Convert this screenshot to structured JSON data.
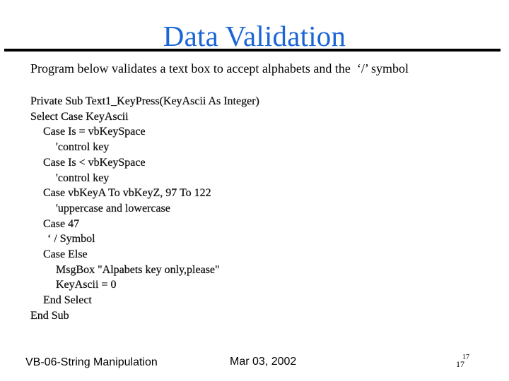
{
  "slide": {
    "title": "Data Validation",
    "title_color": "#1a66d6",
    "intro": "Program below validates a text box to accept alphabets and the  ‘/’ symbol"
  },
  "code": {
    "lines": [
      {
        "text": "Private Sub Text1_KeyPress(KeyAscii As Integer)",
        "indent": 0
      },
      {
        "text": "Select Case KeyAscii",
        "indent": 0
      },
      {
        "text": "Case Is = vbKeySpace",
        "indent": 1
      },
      {
        "text": "'control key",
        "indent": 2
      },
      {
        "text": "Case Is < vbKeySpace",
        "indent": 1
      },
      {
        "text": "'control key",
        "indent": 2
      },
      {
        "text": "Case vbKeyA To vbKeyZ, 97 To 122",
        "indent": 1
      },
      {
        "text": "'uppercase and lowercase",
        "indent": 2
      },
      {
        "text": "Case 47",
        "indent": 1
      },
      {
        "text": "‘ / Symbol",
        "indent": 1
      },
      {
        "text": "Case Else",
        "indent": 1
      },
      {
        "text": "MsgBox \"Alpabets key only,please\"",
        "indent": 2
      },
      {
        "text": "KeyAscii = 0",
        "indent": 2
      },
      {
        "text": "End Select",
        "indent": 1
      },
      {
        "text": "End Sub",
        "indent": 0
      }
    ]
  },
  "footer": {
    "left": "VB-06-String Manipulation",
    "date": "Mar 03, 2002",
    "page_number": "17",
    "page_number_overlay": "17"
  }
}
